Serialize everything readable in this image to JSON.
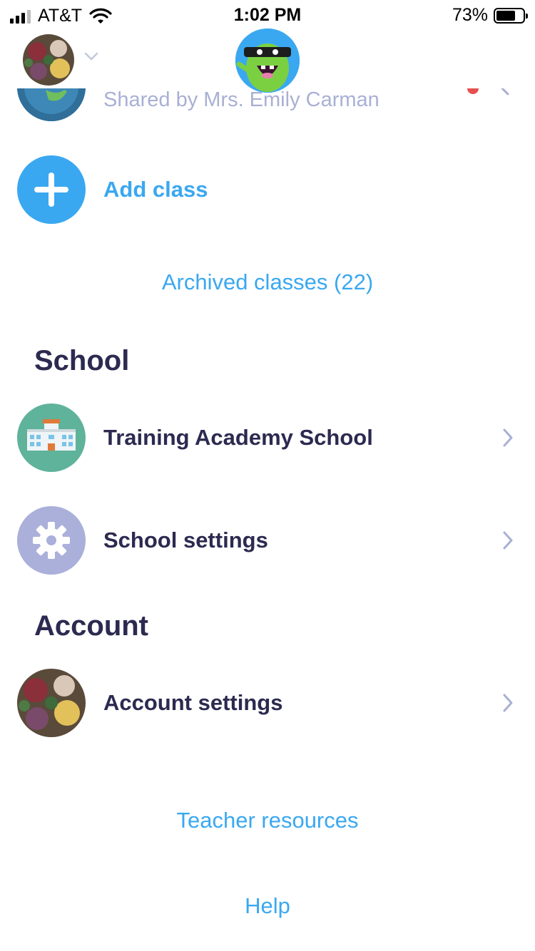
{
  "status_bar": {
    "carrier": "AT&T",
    "time": "1:02 PM",
    "battery_percent": "73%",
    "battery_level": 0.73,
    "signal_bars_active": 3,
    "signal_bars_total": 4
  },
  "header": {
    "avatar_icon": "user-photo-roses",
    "switcher_icon": "chevron-down-icon",
    "logo_icon": "classdojo-monster-logo"
  },
  "classes": {
    "shared_item": {
      "subtitle": "Shared by Mrs. Emily Carman",
      "icon": "globe-icon"
    },
    "add_class_label": "Add class",
    "archived_link": "Archived classes (22)"
  },
  "school": {
    "title": "School",
    "items": [
      {
        "label": "Training Academy School",
        "icon": "school-building-icon"
      },
      {
        "label": "School settings",
        "icon": "gear-icon"
      }
    ]
  },
  "account": {
    "title": "Account",
    "items": [
      {
        "label": "Account settings",
        "icon": "user-photo-roses"
      }
    ]
  },
  "footer": {
    "teacher_resources": "Teacher resources",
    "help": "Help"
  },
  "colors": {
    "accent_blue": "#3aa8f0",
    "text_dark": "#2c2a50",
    "muted_text": "#a9b0d4",
    "school_green": "#5fb39a",
    "settings_lavender": "#aab0da",
    "chevron": "#a9b0d4"
  }
}
